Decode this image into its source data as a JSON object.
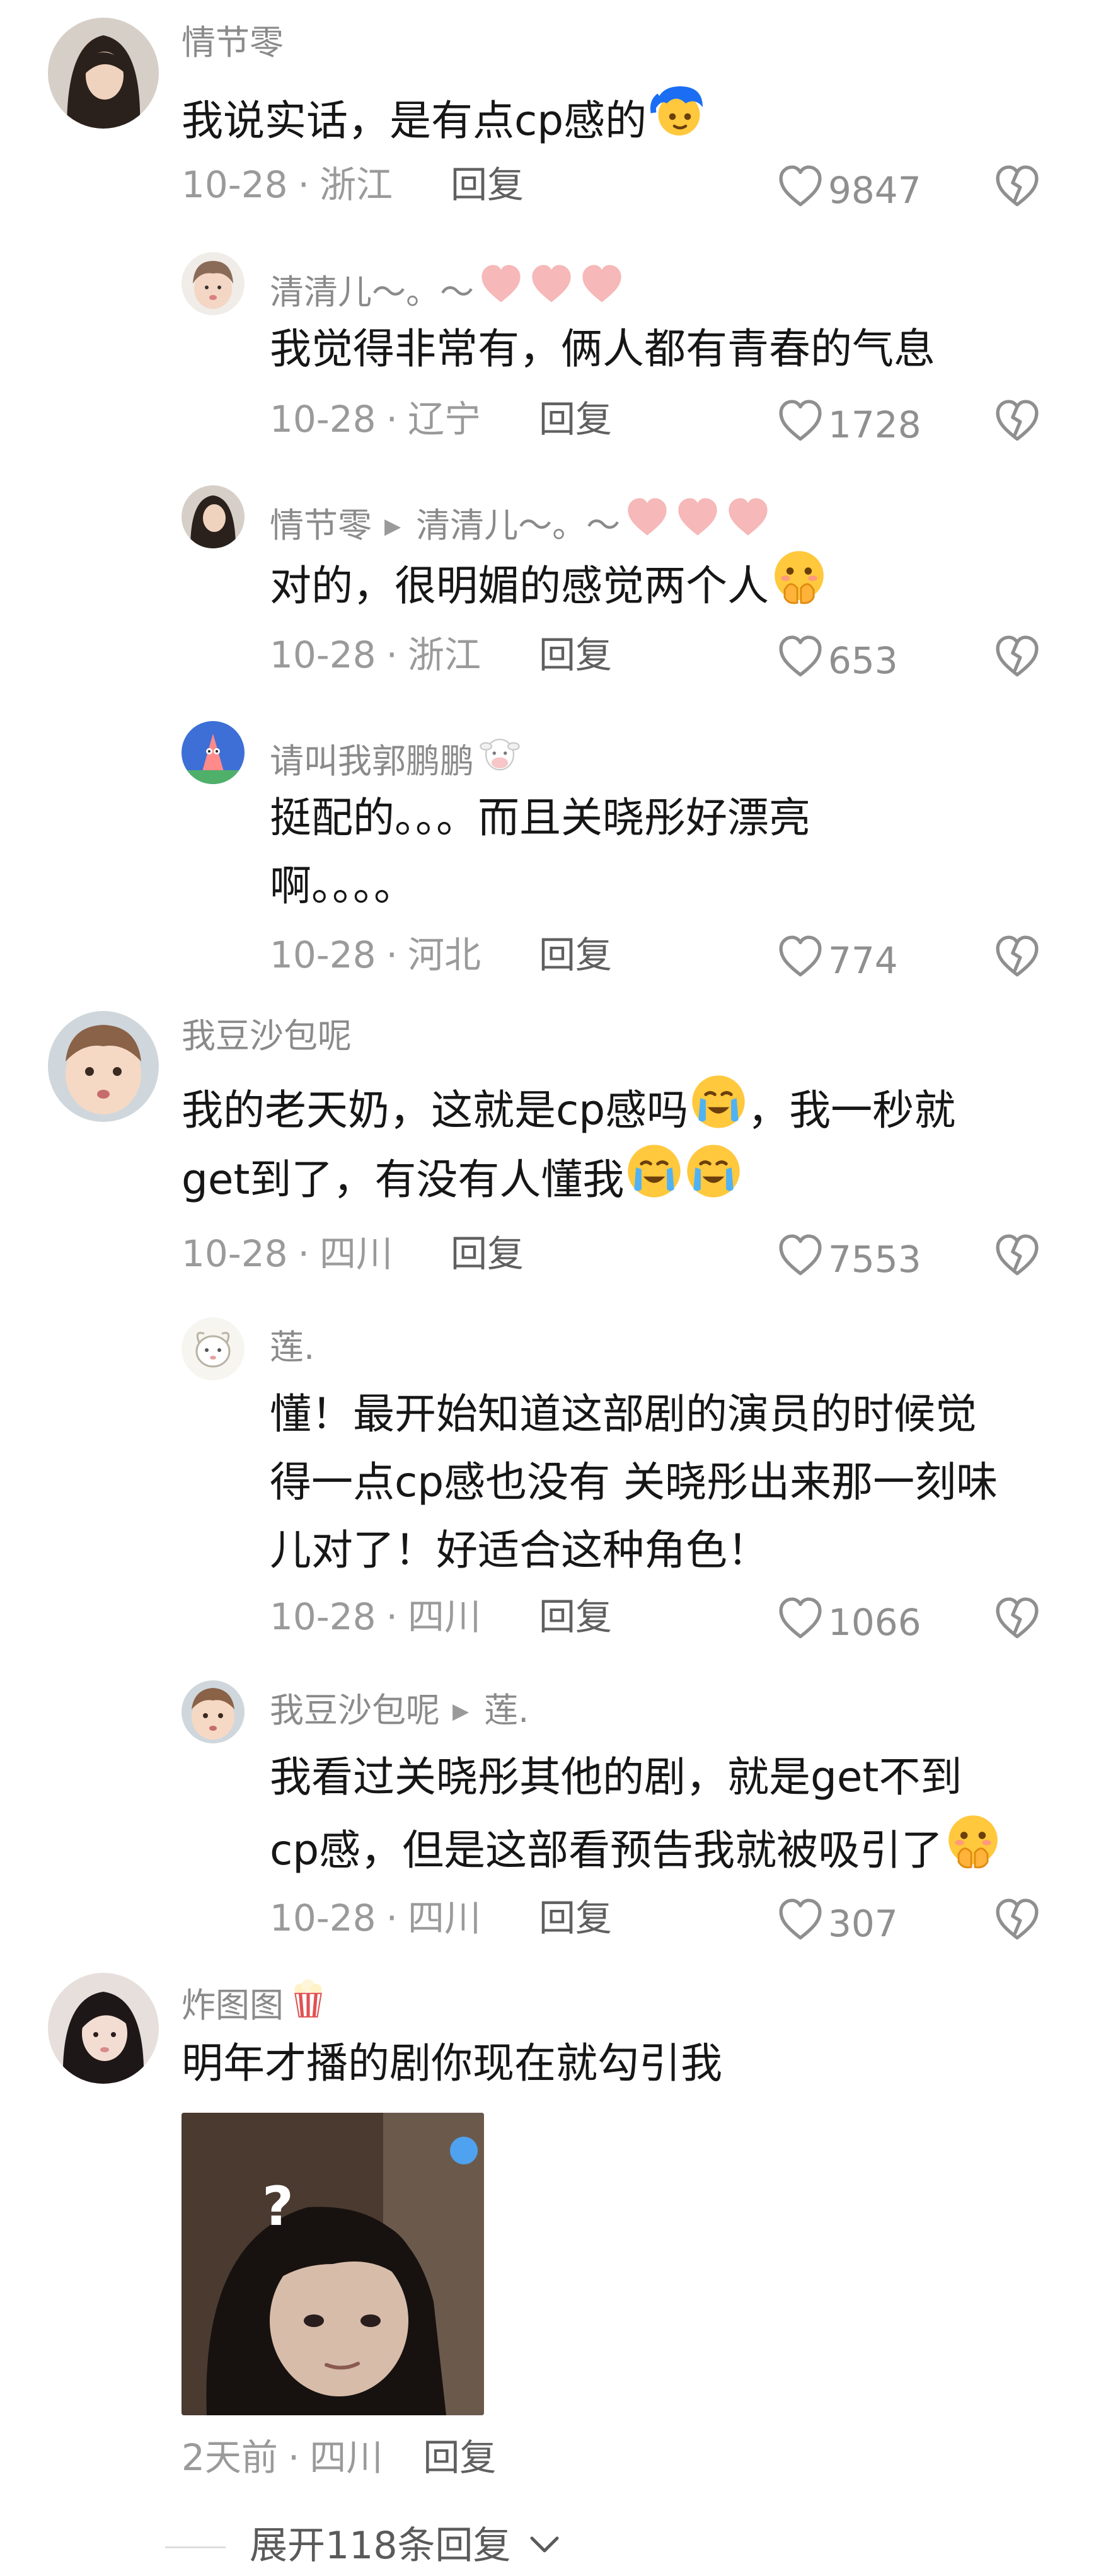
{
  "comments": [
    {
      "user": "情节零",
      "text": "我说实话，是有点cp感的",
      "date": "10-28",
      "region": "浙江",
      "reply_label": "回复",
      "likes": "9847",
      "replies": [
        {
          "user": "清清儿～。～",
          "text": "我觉得非常有，俩人都有青春的气息",
          "date": "10-28",
          "region": "辽宁",
          "reply_label": "回复",
          "likes": "1728"
        },
        {
          "user": "情节零",
          "reply_to": "清清儿～。～",
          "text": "对的，很明媚的感觉两个人",
          "date": "10-28",
          "region": "浙江",
          "reply_label": "回复",
          "likes": "653"
        },
        {
          "user": "请叫我郭鹏鹏",
          "text_line1": "挺配的。。。而且关晓彤好漂亮",
          "text_line2": "啊。。。。",
          "date": "10-28",
          "region": "河北",
          "reply_label": "回复",
          "likes": "774"
        }
      ]
    },
    {
      "user": "我豆沙包呢",
      "text_line1": "我的老天奶，这就是cp感吗",
      "text_line1b": "，我一秒就",
      "text_line2": "get到了，有没有人懂我",
      "date": "10-28",
      "region": "四川",
      "reply_label": "回复",
      "likes": "7553",
      "replies": [
        {
          "user": "莲.",
          "text_line1": "懂！最开始知道这部剧的演员的时候觉",
          "text_line2": "得一点cp感也没有 关晓彤出来那一刻味",
          "text_line3": "儿对了！好适合这种角色！",
          "date": "10-28",
          "region": "四川",
          "reply_label": "回复",
          "likes": "1066"
        },
        {
          "user": "我豆沙包呢",
          "reply_to": "莲.",
          "text_line1": "我看过关晓彤其他的剧，就是get不到",
          "text_line2": "cp感，但是这部看预告我就被吸引了",
          "date": "10-28",
          "region": "四川",
          "reply_label": "回复",
          "likes": "307"
        }
      ]
    },
    {
      "user": "炸图图",
      "text": "明年才播的剧你现在就勾引我",
      "sticker_mark": "?",
      "date": "2天前",
      "region": "四川",
      "reply_label": "回复"
    }
  ],
  "expand_label": "展开118条回复",
  "colors": {
    "meta_gray": "#9a9a9a",
    "name_gray": "#8a8a8a",
    "heart_badge_pink": "#f5b5b5"
  }
}
